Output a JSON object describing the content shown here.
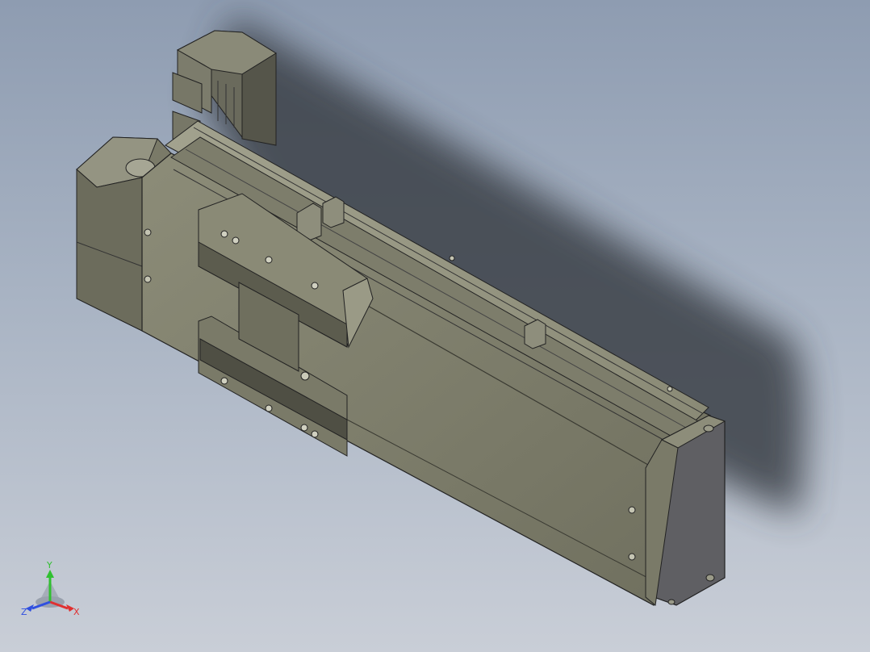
{
  "viewport": {
    "model": "linear-actuator-module",
    "background_top": "#8e9cb1",
    "background_bottom": "#c9ced7",
    "body_color": "#7f7f6c",
    "body_dark": "#5e5e50",
    "body_light": "#9a9a86",
    "end_cap_color": "#606064",
    "motor_color": "#77776a",
    "shadow_color": "#3b3f47"
  },
  "triad": {
    "x_label": "X",
    "y_label": "Y",
    "z_label": "Z",
    "x_color": "#e03030",
    "y_color": "#30c030",
    "z_color": "#3050e0"
  }
}
